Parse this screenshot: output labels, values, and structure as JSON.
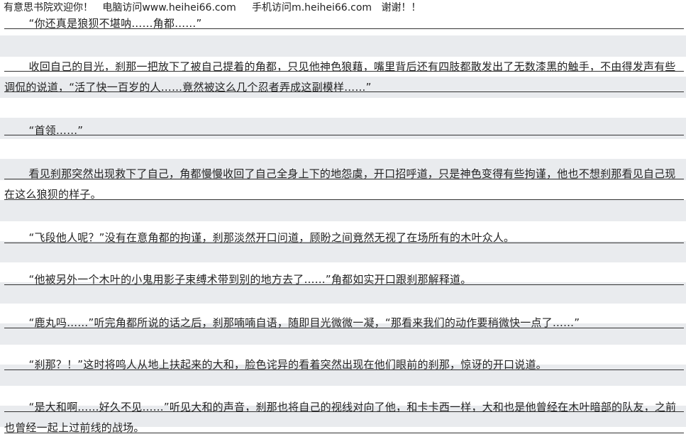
{
  "banner": {
    "welcome": "有意思书院欢迎你！",
    "pc_visit": "电脑访问www.heihei66.com",
    "mobile_visit": "手机访问m.heihei66.com",
    "thanks": "谢谢！！"
  },
  "paragraphs": [
    "“你还真是狼狈不堪呐……角都……”",
    "收回自己的目光，刹那一把放下了被自己提着的角都，只见他神色狼藉，嘴里背后还有四肢都散发出了无数漆黑的触手，不由得发声有些调侃的说道，“活了快一百岁的人……竟然被这么几个忍者弄成这副模样……”",
    "“首领……”",
    "看见刹那突然出现救下了自己，角都慢慢收回了自己全身上下的地怨虞，开口招呼道，只是神色变得有些拘谨，他也不想刹那看见自己现在这么狼狈的样子。",
    "“飞段他人呢？”没有在意角都的拘谨，刹那淡然开口问道，顾盼之间竟然无视了在场所有的木叶众人。",
    "“他被另外一个木叶的小鬼用影子束缚术带到别的地方去了……”角都如实开口跟刹那解释道。",
    "“鹿丸吗……”听完角都所说的话之后，刹那喃喃自语，随即目光微微一凝，“那看来我们的动作要稍微快一点了……”",
    "“刹那？！”这时将鸣人从地上扶起来的大和，脸色诧异的看着突然出现在他们眼前的刹那，惊讶的开口说道。",
    "“是大和啊……好久不见……”听见大和的声音，刹那也将自己的视线对向了他，和卡卡西一样，大和也是他曾经在木叶暗部的队友，之前也曾经一起上过前线的战场。"
  ]
}
